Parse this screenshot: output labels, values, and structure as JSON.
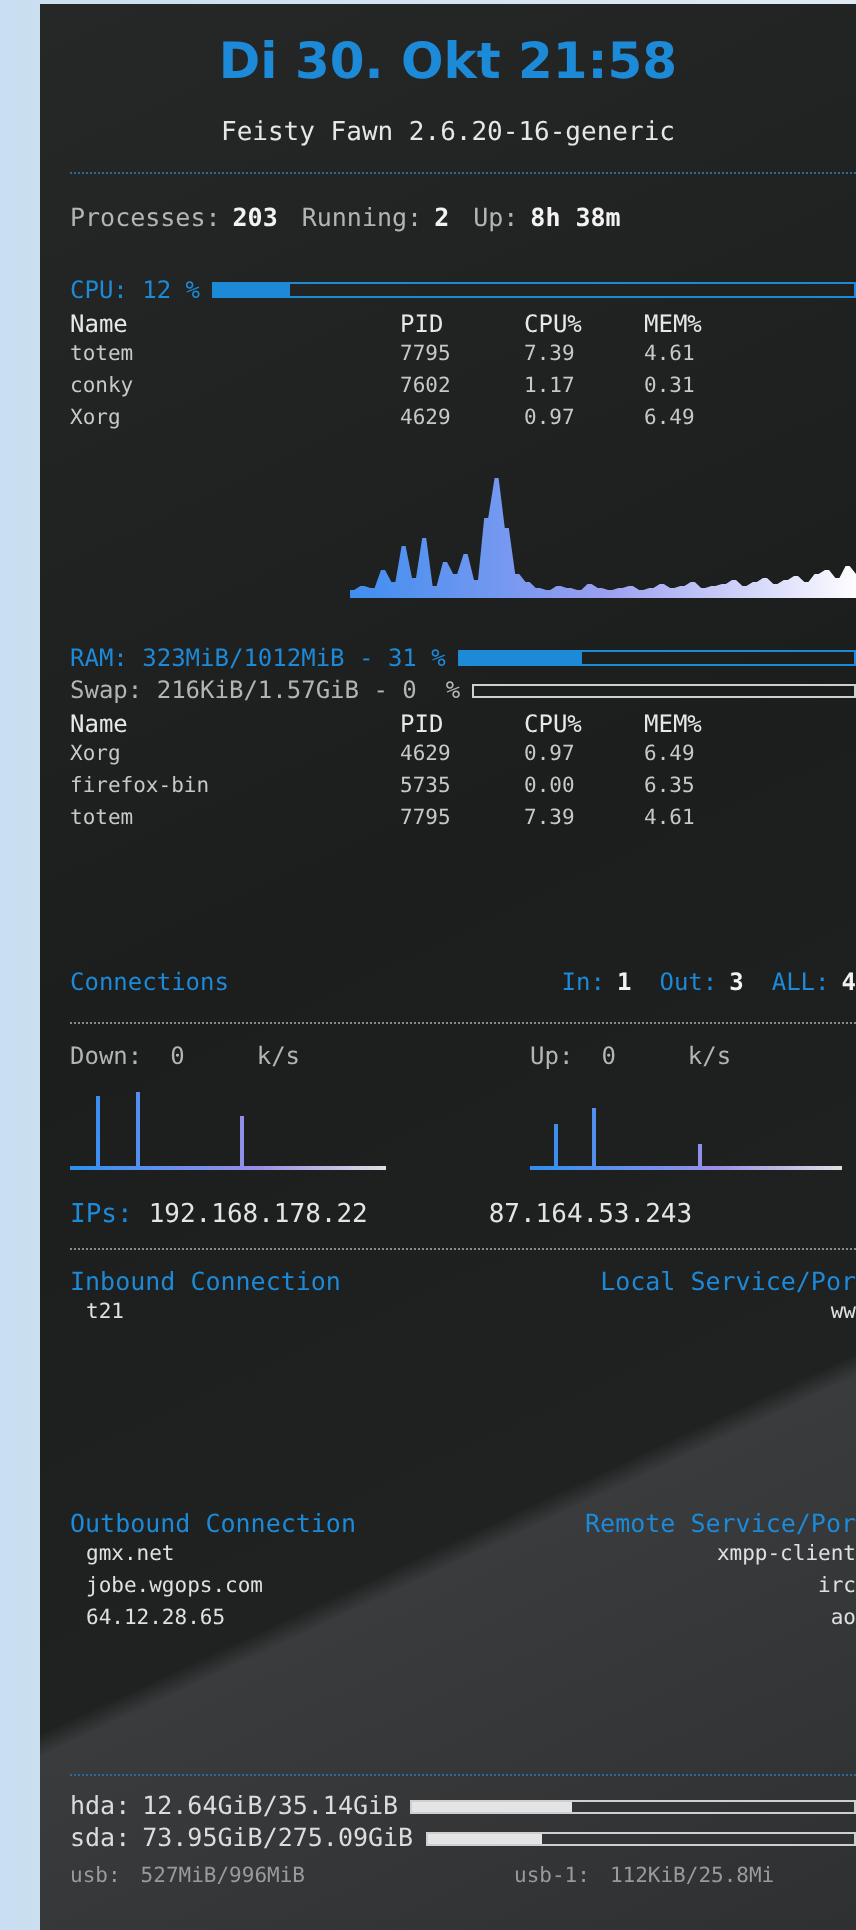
{
  "header": {
    "date": "Di 30. Okt 21:58",
    "system": "Feisty Fawn 2.6.20-16-generic"
  },
  "stats": [
    {
      "label": "Processes:",
      "value": "203"
    },
    {
      "label": "Running:",
      "value": "2"
    },
    {
      "label": "Up:",
      "value": "8h 38m"
    }
  ],
  "cpu": {
    "label": "CPU: 12 %",
    "level": 0.12,
    "columns": [
      "Name",
      "PID",
      "CPU%",
      "MEM%"
    ],
    "rows": [
      [
        "totem",
        "7795",
        "7.39",
        "4.61"
      ],
      [
        "conky",
        "7602",
        "1.17",
        "0.31"
      ],
      [
        "Xorg",
        "4629",
        "0.97",
        "6.49"
      ]
    ]
  },
  "memory": {
    "ram": {
      "label": "RAM: 323MiB/1012MiB - 31 %",
      "level": 0.31
    },
    "swap": {
      "label": "Swap: 216KiB/1.57GiB - 0  %",
      "level": 0
    },
    "columns": [
      "Name",
      "PID",
      "CPU%",
      "MEM%"
    ],
    "rows": [
      [
        "Xorg",
        "4629",
        "0.97",
        "6.49"
      ],
      [
        "firefox-bin",
        "5735",
        "0.00",
        "6.35"
      ],
      [
        "totem",
        "7795",
        "7.39",
        "4.61"
      ]
    ]
  },
  "connections": {
    "title": "Connections",
    "counts": [
      {
        "label": "In:",
        "value": "1"
      },
      {
        "label": "Out:",
        "value": "3"
      },
      {
        "label": "ALL:",
        "value": "4"
      }
    ]
  },
  "network": {
    "down": {
      "label": "Down:",
      "value": "0",
      "unit": "k/s"
    },
    "up": {
      "label": "Up:",
      "value": "0",
      "unit": "k/s"
    },
    "ips_label": "IPs:",
    "ips": [
      "192.168.178.22",
      "87.164.53.243"
    ]
  },
  "inbound": {
    "headings": [
      "Inbound Connection",
      "Local Service/Por"
    ],
    "rows": [
      [
        "t21",
        "ww"
      ]
    ]
  },
  "outbound": {
    "headings": [
      "Outbound Connection",
      "Remote Service/Por"
    ],
    "rows": [
      [
        "gmx.net",
        "xmpp-client"
      ],
      [
        "jobe.wgops.com",
        "irc"
      ],
      [
        "64.12.28.65",
        "ao"
      ]
    ]
  },
  "disks": [
    {
      "label": "hda:",
      "value": "12.64GiB/35.14GiB",
      "level": 0.36
    },
    {
      "label": "sda:",
      "value": "73.95GiB/275.09GiB",
      "level": 0.27
    }
  ],
  "usb": [
    {
      "label": "usb:",
      "value": "527MiB/996MiB"
    },
    {
      "label": "usb-1:",
      "value": "112KiB/25.8Mi"
    }
  ]
}
